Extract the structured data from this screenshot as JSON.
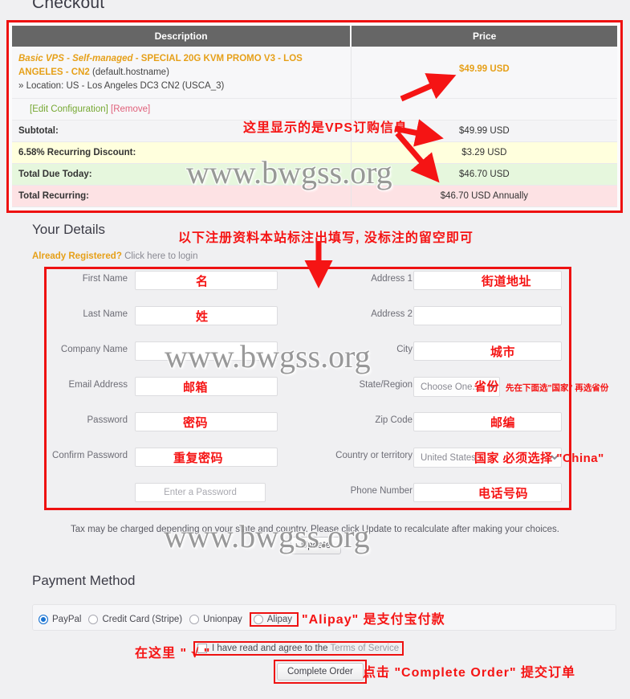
{
  "page": {
    "heading": "Checkout",
    "watermark": "www.bwgss.org"
  },
  "order_summary": {
    "columns": [
      "Description",
      "Price"
    ],
    "product": {
      "name_italic": "Basic VPS - Self-managed",
      "name_rest": " - SPECIAL 20G KVM PROMO V3 - LOS ANGELES - CN2",
      "hostname": " (default.hostname)",
      "location": "» Location: US - Los Angeles DC3 CN2 (USCA_3)",
      "price": "$49.99 USD",
      "edit_link": "[Edit Configuration]",
      "remove_link": "[Remove]"
    },
    "rows": [
      {
        "label": "Subtotal:",
        "value": "$49.99 USD"
      },
      {
        "label": "6.58% Recurring Discount:",
        "value": "$3.29 USD"
      },
      {
        "label": "Total Due Today:",
        "value": "$46.70 USD"
      },
      {
        "label": "Total Recurring:",
        "value": "$46.70 USD Annually"
      }
    ],
    "annotation": "这里显示的是VPS订购信息"
  },
  "your_details": {
    "title": "Your Details",
    "already_registered_bold": "Already Registered?",
    "already_registered_link": "Click here to login",
    "annotation": "以下注册资料本站标注出填写, 没标注的留空即可",
    "left_fields": [
      {
        "label": "First Name",
        "value": "",
        "placeholder": "",
        "overlay": "名"
      },
      {
        "label": "Last Name",
        "value": "",
        "placeholder": "",
        "overlay": "姓"
      },
      {
        "label": "Company Name",
        "value": "",
        "placeholder": "",
        "overlay": ""
      },
      {
        "label": "Email Address",
        "value": "",
        "placeholder": "",
        "overlay": "邮箱"
      },
      {
        "label": "Password",
        "value": "",
        "placeholder": "",
        "overlay": "密码"
      },
      {
        "label": "Confirm Password",
        "value": "",
        "placeholder": "",
        "overlay": "重复密码"
      },
      {
        "label": "",
        "value": "",
        "placeholder": "Enter a Password",
        "overlay": ""
      }
    ],
    "right_fields": [
      {
        "label": "Address 1",
        "value": "",
        "placeholder": "",
        "overlay": "街道地址"
      },
      {
        "label": "Address 2",
        "value": "",
        "placeholder": "",
        "overlay": ""
      },
      {
        "label": "City",
        "value": "",
        "placeholder": "",
        "overlay": "城市"
      },
      {
        "label": "State/Region",
        "value": "Choose One...",
        "placeholder": "",
        "overlay": "省份",
        "note": "先在下面选\"国家\" 再选省份",
        "is_select": true
      },
      {
        "label": "Zip Code",
        "value": "",
        "placeholder": "",
        "overlay": "邮编"
      },
      {
        "label": "Country or territory",
        "value": "United States",
        "placeholder": "",
        "overlay": "国家 必须选择 \"China\"",
        "is_select": true
      },
      {
        "label": "Phone Number",
        "value": "",
        "placeholder": "",
        "overlay": "电话号码"
      }
    ]
  },
  "tax": {
    "note": "Tax may be charged depending on your state and country. Please click Update to recalculate after making your choices.",
    "update_label": "Update"
  },
  "payment": {
    "title": "Payment Method",
    "options": [
      {
        "label": "PayPal",
        "selected": true
      },
      {
        "label": "Credit Card (Stripe)",
        "selected": false
      },
      {
        "label": "Unionpay",
        "selected": false
      },
      {
        "label": "Alipay",
        "selected": false
      }
    ],
    "alipay_annotation": "\"Alipay\" 是支付宝付款",
    "tos_prefix": "I have read and agree to the ",
    "tos_link": "Terms of Service",
    "tos_annotation": "在这里 \" √ \"",
    "complete_order_label": "Complete Order",
    "complete_order_annotation": "点击 \"Complete Order\" 提交订单"
  },
  "colors": {
    "annotation_red": "#f51414",
    "table_header": "#666666",
    "product_orange": "#e6a019",
    "discount_row": "#ffffdd",
    "today_row": "#e6f7dd",
    "recurring_row": "#fde2e4",
    "radio_selected": "#1a73d1"
  }
}
